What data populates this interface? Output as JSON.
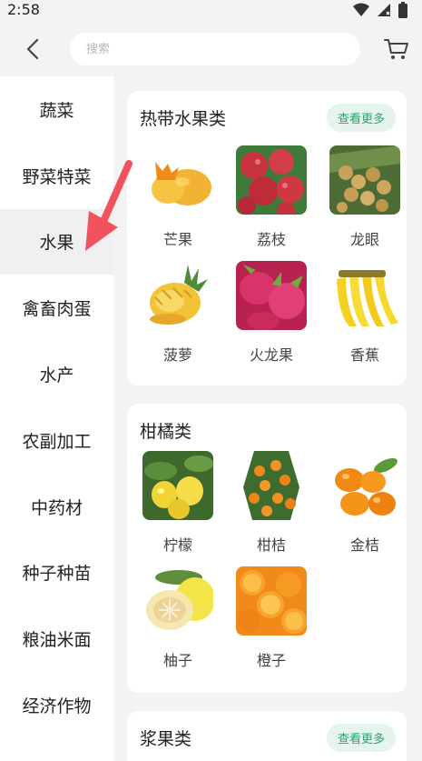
{
  "status": {
    "time": "2:58"
  },
  "search": {
    "placeholder": "搜索"
  },
  "sidebar": {
    "items": [
      {
        "label": "蔬菜",
        "active": false
      },
      {
        "label": "野菜特菜",
        "active": false
      },
      {
        "label": "水果",
        "active": true
      },
      {
        "label": "禽畜肉蛋",
        "active": false
      },
      {
        "label": "水产",
        "active": false
      },
      {
        "label": "农副加工",
        "active": false
      },
      {
        "label": "中药材",
        "active": false
      },
      {
        "label": "种子种苗",
        "active": false
      },
      {
        "label": "粮油米面",
        "active": false
      },
      {
        "label": "经济作物",
        "active": false
      }
    ]
  },
  "sections": [
    {
      "title": "热带水果类",
      "more": "查看更多",
      "items": [
        {
          "name": "芒果",
          "icon": "mango-image"
        },
        {
          "name": "荔枝",
          "icon": "lychee-image"
        },
        {
          "name": "龙眼",
          "icon": "longan-image"
        },
        {
          "name": "菠萝",
          "icon": "pineapple-image"
        },
        {
          "name": "火龙果",
          "icon": "dragon-fruit-image"
        },
        {
          "name": "香蕉",
          "icon": "banana-image"
        }
      ]
    },
    {
      "title": "柑橘类",
      "items": [
        {
          "name": "柠檬",
          "icon": "lemon-image"
        },
        {
          "name": "柑桔",
          "icon": "tangerine-image"
        },
        {
          "name": "金桔",
          "icon": "kumquat-image"
        },
        {
          "name": "柚子",
          "icon": "pomelo-image"
        },
        {
          "name": "橙子",
          "icon": "orange-image"
        }
      ]
    },
    {
      "title": "浆果类",
      "more": "查看更多"
    }
  ],
  "colors": {
    "accent": "#2aa36b",
    "accent_bg": "#e6f4ee",
    "annotation_arrow": "#f0525e"
  }
}
